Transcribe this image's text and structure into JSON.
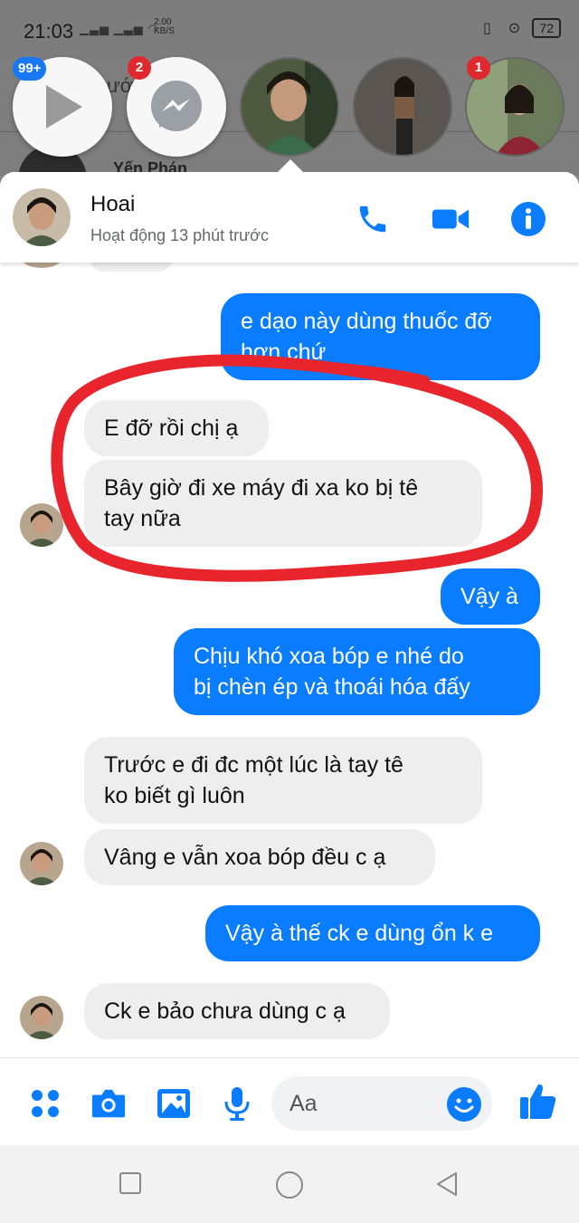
{
  "status_bar": {
    "time": "21:03",
    "net_speed_value": "2.00",
    "net_speed_unit": "KB/S",
    "battery": "72"
  },
  "background": {
    "title_fragment": "ướ        ếr",
    "contact_fragment": "Yến Phán"
  },
  "chat_heads": [
    {
      "name": "video-head",
      "badge": "99+"
    },
    {
      "name": "messenger-head",
      "badge": "2"
    },
    {
      "name": "contact-head-1",
      "badge": ""
    },
    {
      "name": "contact-head-2",
      "badge": ""
    },
    {
      "name": "contact-head-3",
      "badge": "1"
    }
  ],
  "header": {
    "name": "Hoai",
    "status": "Hoạt động 13 phút trước"
  },
  "messages": [
    {
      "side": "out",
      "lines": [
        "e dạo này dùng thuốc đỡ",
        "hơn chứ"
      ]
    },
    {
      "side": "in",
      "lines": [
        "E đỡ rồi chị ạ"
      ]
    },
    {
      "side": "in",
      "lines": [
        "Bây giờ đi xe máy đi xa ko bị tê",
        "tay nữa"
      ]
    },
    {
      "side": "out",
      "lines": [
        "Vậy à"
      ]
    },
    {
      "side": "out",
      "lines": [
        "Chịu khó xoa bóp e nhé do",
        "bị chèn ép và thoái hóa đấy"
      ]
    },
    {
      "side": "in",
      "lines": [
        "Trước e đi đc một lúc là tay tê",
        "ko biết gì luôn"
      ]
    },
    {
      "side": "in",
      "lines": [
        "Vâng e vẫn xoa bóp đều c ạ"
      ]
    },
    {
      "side": "out",
      "lines": [
        "Vậy à thế ck e dùng ổn k e"
      ]
    },
    {
      "side": "in",
      "lines": [
        "Ck e bảo chưa dùng c ạ"
      ]
    }
  ],
  "composer": {
    "placeholder": "Aa"
  },
  "colors": {
    "accent": "#0a7cff",
    "incoming_bubble": "#eeeeef",
    "highlight_ring": "#e8242c",
    "badge": "#e0292f"
  }
}
